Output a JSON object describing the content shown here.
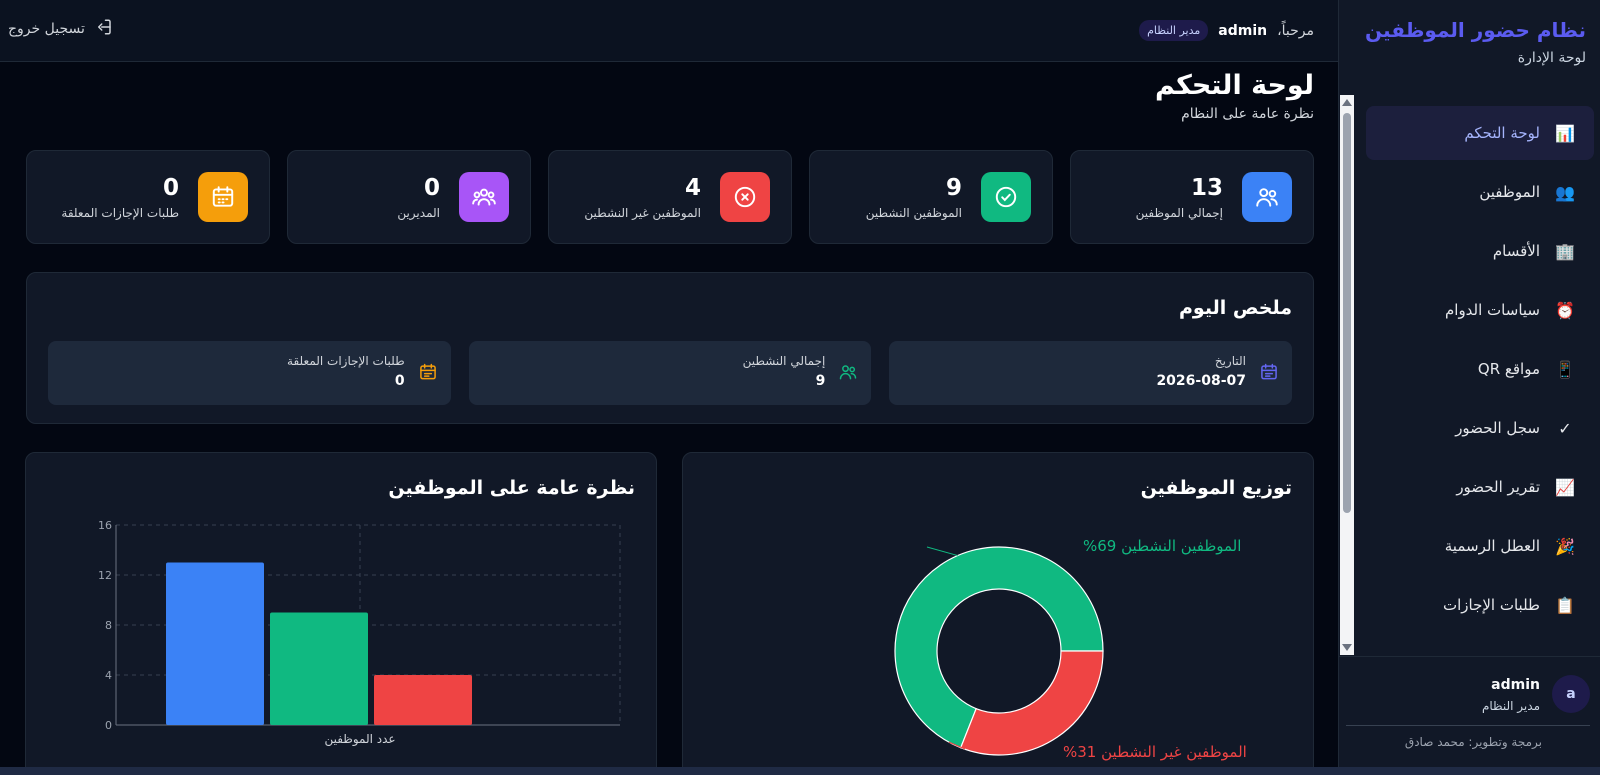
{
  "sidebar": {
    "title": "نظام حضور الموظفين",
    "subtitle": "لوحة الإدارة",
    "items": [
      {
        "label": "لوحة التحكم",
        "icon": "📊",
        "icon_name": "bar-chart-icon"
      },
      {
        "label": "الموظفين",
        "icon": "👥",
        "icon_name": "people-icon"
      },
      {
        "label": "الأقسام",
        "icon": "🏢",
        "icon_name": "building-icon"
      },
      {
        "label": "سياسات الدوام",
        "icon": "⏰",
        "icon_name": "alarm-clock-icon"
      },
      {
        "label": "مواقع QR",
        "icon": "📱",
        "icon_name": "phone-icon"
      },
      {
        "label": "سجل الحضور",
        "icon": "✓",
        "icon_name": "check-icon"
      },
      {
        "label": "تقرير الحضور",
        "icon": "📈",
        "icon_name": "trend-chart-icon"
      },
      {
        "label": "العطل الرسمية",
        "icon": "🎉",
        "icon_name": "party-icon"
      },
      {
        "label": "طلبات الإجازات",
        "icon": "📋",
        "icon_name": "clipboard-icon"
      }
    ],
    "user": {
      "avatar": "a",
      "name": "admin",
      "role": "مدير النظام"
    },
    "credit": "برمجة وتطوير: محمد صادق"
  },
  "topbar": {
    "greeting": "مرحباً،",
    "username": "admin",
    "role_badge": "مدير النظام",
    "logout": "تسجيل خروج"
  },
  "page": {
    "title": "لوحة التحكم",
    "subtitle": "نظرة عامة على النظام"
  },
  "stats": [
    {
      "value": "13",
      "label": "إجمالي الموظفين",
      "color": "#3b82f6"
    },
    {
      "value": "9",
      "label": "الموظفين النشطين",
      "color": "#10b981"
    },
    {
      "value": "4",
      "label": "الموظفين غير النشطين",
      "color": "#ef4444"
    },
    {
      "value": "0",
      "label": "المديرين",
      "color": "#a855f7"
    },
    {
      "value": "0",
      "label": "طلبات الإجازات المعلقة",
      "color": "#f59e0b"
    }
  ],
  "summary": {
    "title": "ملخص اليوم",
    "items": [
      {
        "label": "التاريخ",
        "value": "2026-08-07",
        "color": "#6366f1"
      },
      {
        "label": "إجمالي النشطين",
        "value": "9",
        "color": "#10b981"
      },
      {
        "label": "طلبات الإجازات المعلقة",
        "value": "0",
        "color": "#f59e0b"
      }
    ]
  },
  "distribution": {
    "title": "توزيع الموظفين"
  },
  "overview": {
    "title": "نظرة عامة على الموظفين"
  },
  "chart_data": [
    {
      "type": "pie",
      "title": "توزيع الموظفين",
      "slices": [
        {
          "label": "الموظفين النشطين",
          "value": 69,
          "color": "#10b981"
        },
        {
          "label": "الموظفين غير النشطين",
          "value": 31,
          "color": "#ef4444"
        }
      ],
      "label_format": "%{value}",
      "donut": true
    },
    {
      "type": "bar",
      "title": "نظرة عامة على الموظفين",
      "categories": [
        "عدد الموظفين"
      ],
      "series": [
        {
          "value": 13,
          "color": "#3b82f6"
        },
        {
          "value": 9,
          "color": "#10b981"
        },
        {
          "value": 4,
          "color": "#ef4444"
        }
      ],
      "ylim": [
        0,
        16
      ],
      "yticks": [
        0,
        4,
        8,
        12,
        16
      ],
      "grid": true
    }
  ]
}
